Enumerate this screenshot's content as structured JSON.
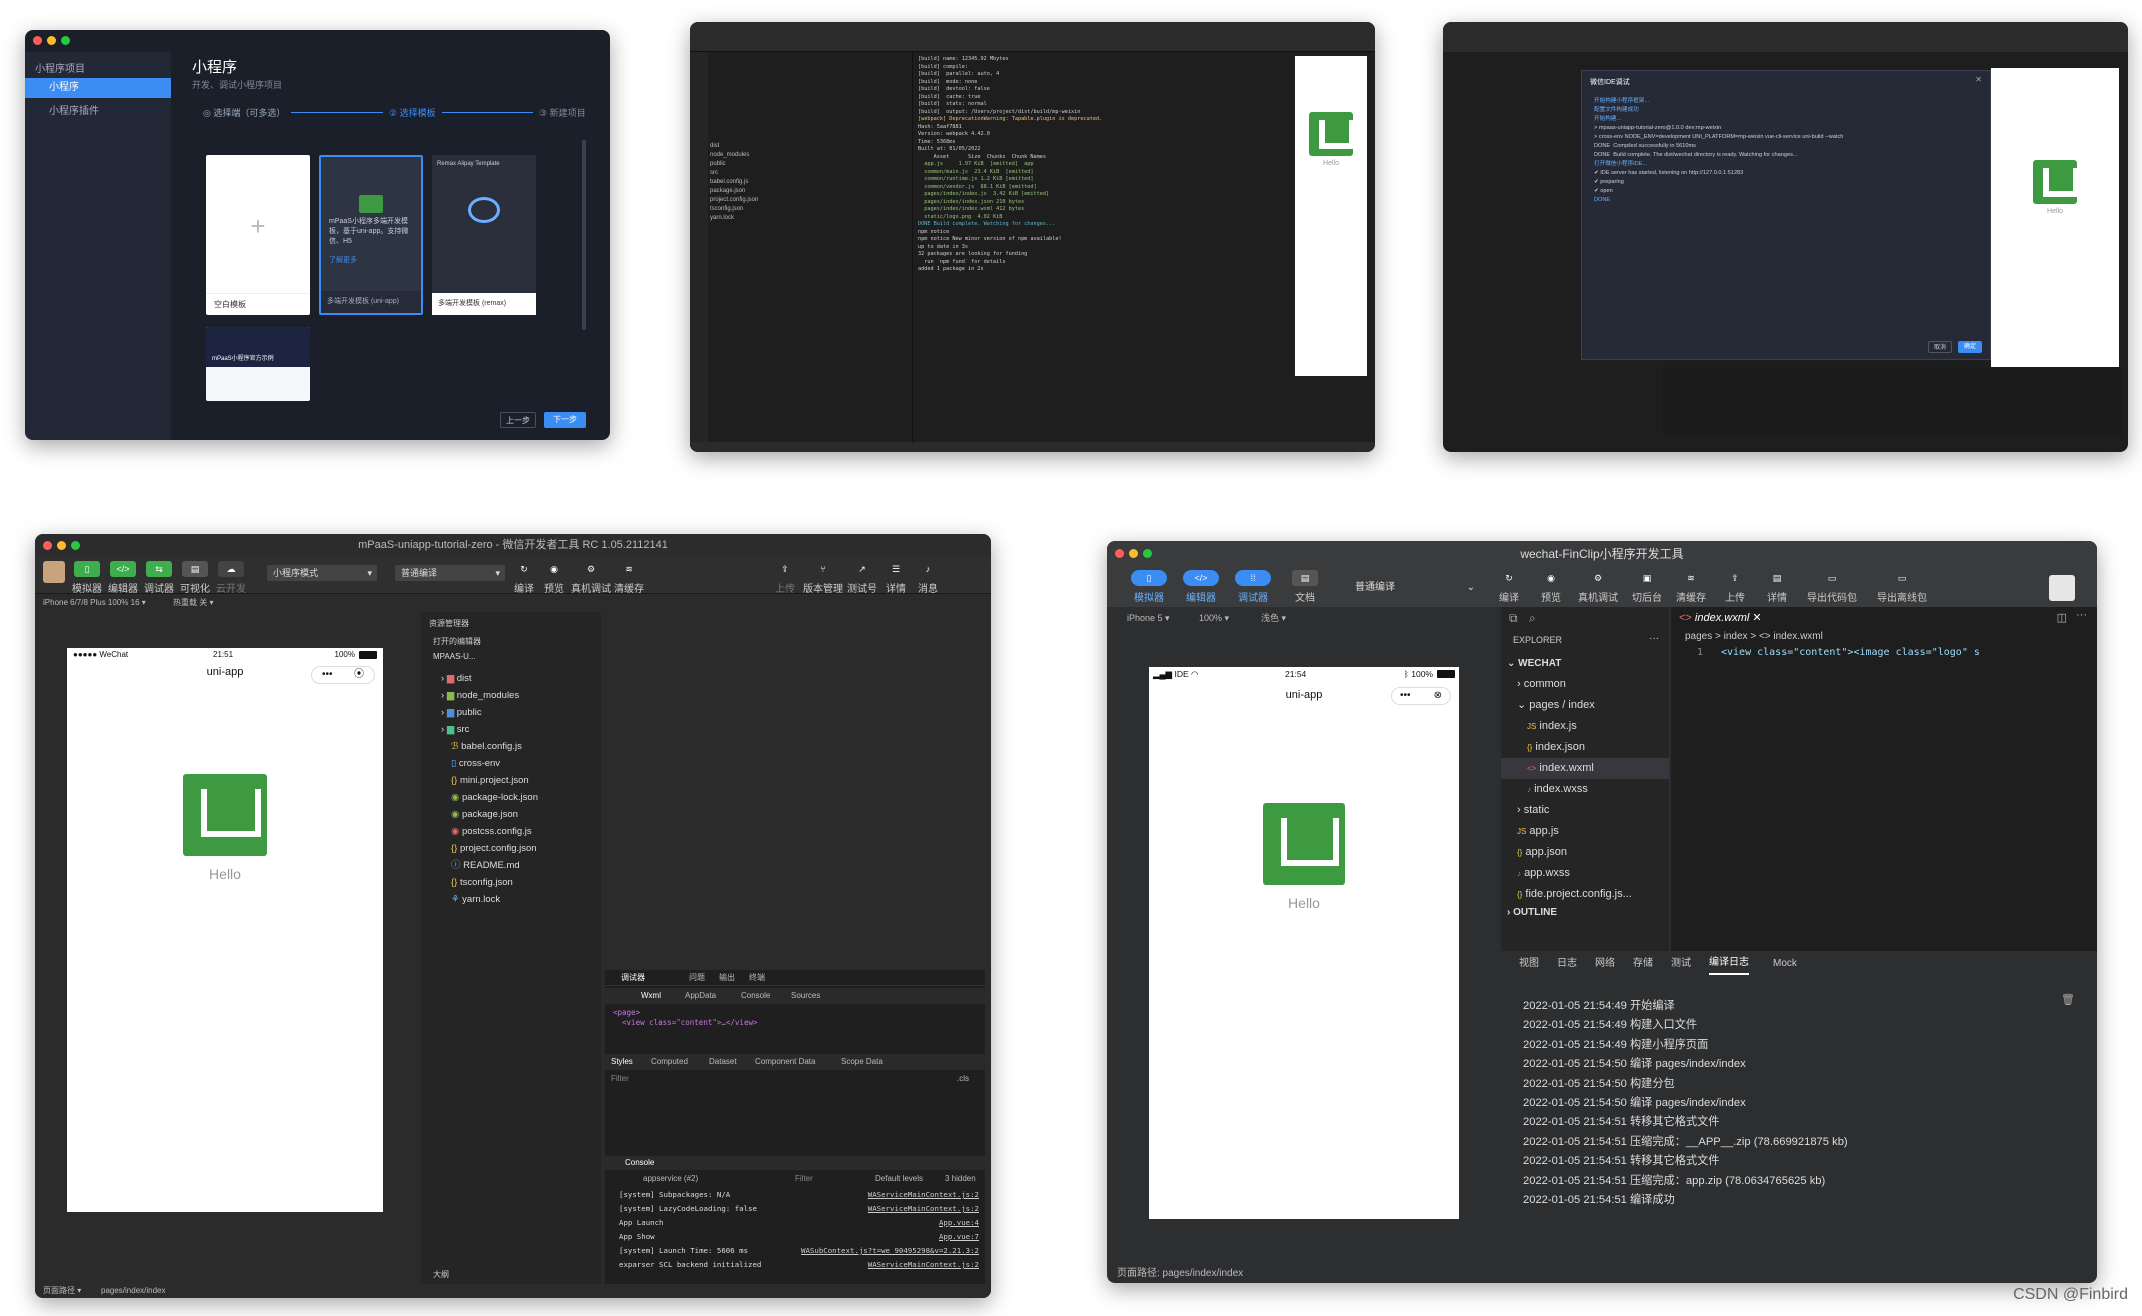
{
  "p1": {
    "sidebar": [
      "小程序项目",
      "小程序",
      "小程序插件"
    ],
    "title": "小程序",
    "subtitle": "开发、调试小程序项目",
    "steps": [
      "选择端（可多选）",
      "选择模板",
      "新建项目"
    ],
    "cards": [
      {
        "label": "空白模板"
      },
      {
        "label": "多端开发模板 (uni-app)",
        "desc": "mPaaS小程序多端开发模板，基于uni-app。支持微信、H5",
        "link": "了解更多"
      },
      {
        "label": "多端开发模板 (remax)",
        "head": "Remax Alipay Template"
      },
      {
        "label": "mPaaS小程序官方示例"
      }
    ],
    "prev": "上一步",
    "next": "下一步"
  },
  "p2": {
    "logs": [
      "[build] name: 12345.92 Mbytes",
      "[build] compile:",
      "[build]  parallel: auto, 4",
      "[build]  mode: none",
      "[build]  devtool: false",
      "[build]  cache: true",
      "[build]  stats: normal",
      "[build]  output: /Users/project/dist/build/mp-weixin",
      "",
      "[webpack] DeprecationWarning: Tapable.plugin is deprecated.",
      "",
      "Hash: 5aaf7881",
      "Version: webpack 4.42.0",
      "Time: 5368ms",
      "Built at: 01/05/2022",
      "     Asset      Size  Chunks  Chunk Names",
      "  app.js     1.97 KiB  [emitted]  app",
      "  common/main.js  23.4 KiB  [emitted]",
      "  common/runtime.js 1.2 KiB [emitted]",
      "  common/vendor.js  88.1 KiB [emitted]",
      "  pages/index/index.js  3.42 KiB [emitted]",
      "  pages/index/index.json 210 bytes",
      "  pages/index/index.wxml 412 bytes",
      "  static/logo.png  4.02 KiB",
      "",
      "DONE Build complete. Watching for changes...",
      "",
      "npm notice",
      "npm notice New minor version of npm available!",
      "",
      "up to date in 3s",
      "",
      "32 packages are looking for funding",
      "  run `npm fund` for details",
      "",
      "added 1 package in 2s"
    ],
    "tree": [
      "dist",
      "node_modules",
      "public",
      "src",
      "babel.config.js",
      "package.json",
      "project.config.json",
      "tsconfig.json",
      "yarn.lock"
    ],
    "hello": "Hello"
  },
  "p3": {
    "dialog_title": "微信IDE调试",
    "lines": [
      "开始构建小程序框架...",
      "配置文件构建成功",
      "",
      "开始构建...",
      "> mpaas-uniapp-tutorial-zero@1.0.0 dev:mp-weixin",
      "> cross-env NODE_ENV=development UNI_PLATFORM=mp-weixin vue-cli-service uni-build --watch",
      "",
      "DONE  Compiled successfully in 5610ms",
      "",
      "DONE  Build complete. The dist/wechat directory is ready. Watching for changes...",
      "",
      "打开微信小程序IDE...",
      "✔ IDE server has started, listening on http://127.0.0.1:51283",
      "✔ preparing",
      "✔ open",
      "DONE"
    ],
    "cancel": "取消",
    "confirm": "确定",
    "hello": "Hello"
  },
  "p4": {
    "window_title": "mPaaS-uniapp-tutorial-zero - 微信开发者工具 RC 1.05.2112141",
    "toolbar": [
      "模拟器",
      "编辑器",
      "调试器",
      "可视化",
      "云开发"
    ],
    "mode": "小程序模式",
    "compile": "普通编译",
    "actions": [
      "编译",
      "预览",
      "真机调试",
      "清缓存"
    ],
    "right": [
      "上传",
      "版本管理",
      "测试号",
      "详情",
      "消息"
    ],
    "device": "iPhone 6/7/8 Plus 100% 16 ▾",
    "hotreload": "热重载 关 ▾",
    "phone_status_left": "●●●●● WeChat",
    "phone_time": "21:51",
    "phone_battery": "100%",
    "page_title": "uni-app",
    "hello": "Hello",
    "explorer": "资源管理器",
    "open_editors": "打开的编辑器",
    "project": "MPAAS-U...",
    "files": [
      "dist",
      "node_modules",
      "public",
      "src",
      "babel.config.js",
      "cross-env",
      "mini.project.json",
      "package-lock.json",
      "package.json",
      "postcss.config.js",
      "project.config.json",
      "README.md",
      "tsconfig.json",
      "yarn.lock"
    ],
    "outline": "大纲",
    "dbg_tabs": [
      "调试器",
      "问题",
      "输出",
      "终端"
    ],
    "dev_tabs": [
      "Wxml",
      "AppData",
      "Console",
      "Sources"
    ],
    "wxml": [
      "<page>",
      "  <view class=\"content\">…</view>"
    ],
    "style_tabs": [
      "Styles",
      "Computed",
      "Dataset",
      "Component Data",
      "Scope Data"
    ],
    "filter": "Filter",
    "cls": ".cls",
    "console": "Console",
    "ctx": "appservice (#2)",
    "levels": "Default levels",
    "hidden": "3 hidden",
    "logs": [
      [
        "[system] Subpackages: N/A",
        "WAServiceMainContext.js:2"
      ],
      [
        "[system] LazyCodeLoading: false",
        "WAServiceMainContext.js:2"
      ],
      [
        "App Launch",
        "App.vue:4"
      ],
      [
        "App Show",
        "App.vue:7"
      ],
      [
        "[system] Launch Time: 5606 ms",
        "WASubContext.js?t=we_90495298&v=2.21.3:2"
      ],
      [
        "exparser SCL backend initialized",
        "WAServiceMainContext.js:2"
      ]
    ],
    "path": "页面路径 ▾",
    "path_value": "pages/index/index"
  },
  "p5": {
    "window_title": "wechat-FinClip小程序开发工具",
    "toolbar": [
      "模拟器",
      "编辑器",
      "调试器",
      "文档"
    ],
    "compile": "普通编译",
    "actions": [
      "编译",
      "预览",
      "真机调试",
      "切后台",
      "清缓存",
      "上传",
      "详情",
      "导出代码包",
      "导出离线包"
    ],
    "device": "iPhone 5 ▾",
    "zoom": "100% ▾",
    "theme": "浅色 ▾",
    "phone_left": "IDE",
    "phone_time": "21:54",
    "phone_batt": "100%",
    "page_title": "uni-app",
    "hello": "Hello",
    "explorer": "EXPLORER",
    "root": "WECHAT",
    "files": [
      "common",
      "pages / index",
      "index.js",
      "index.json",
      "index.wxml",
      "index.wxss",
      "static",
      "app.js",
      "app.json",
      "app.wxss",
      "fide.project.config.js..."
    ],
    "outline": "OUTLINE",
    "tab": "index.wxml",
    "crumbs": "pages > index > <> index.wxml",
    "code_line": "1",
    "code": "<view class=\"content\"><image class=\"logo\" s",
    "log_tabs": [
      "视图",
      "日志",
      "网络",
      "存储",
      "测试",
      "编译日志",
      "Mock"
    ],
    "logs": [
      "2022-01-05 21:54:49 开始编译",
      "2022-01-05 21:54:49 构建入口文件",
      "2022-01-05 21:54:49 构建小程序页面",
      "2022-01-05 21:54:50 编译 pages/index/index",
      "2022-01-05 21:54:50 构建分包",
      "2022-01-05 21:54:50 编译 pages/index/index",
      "2022-01-05 21:54:51 转移其它格式文件",
      "2022-01-05 21:54:51 压缩完成：__APP__.zip (78.669921875 kb)",
      "2022-01-05 21:54:51 转移其它格式文件",
      "2022-01-05 21:54:51 压缩完成：app.zip (78.0634765625 kb)",
      "2022-01-05 21:54:51 编译成功"
    ],
    "path": "页面路径: pages/index/index"
  },
  "watermark": "CSDN @Finbird"
}
